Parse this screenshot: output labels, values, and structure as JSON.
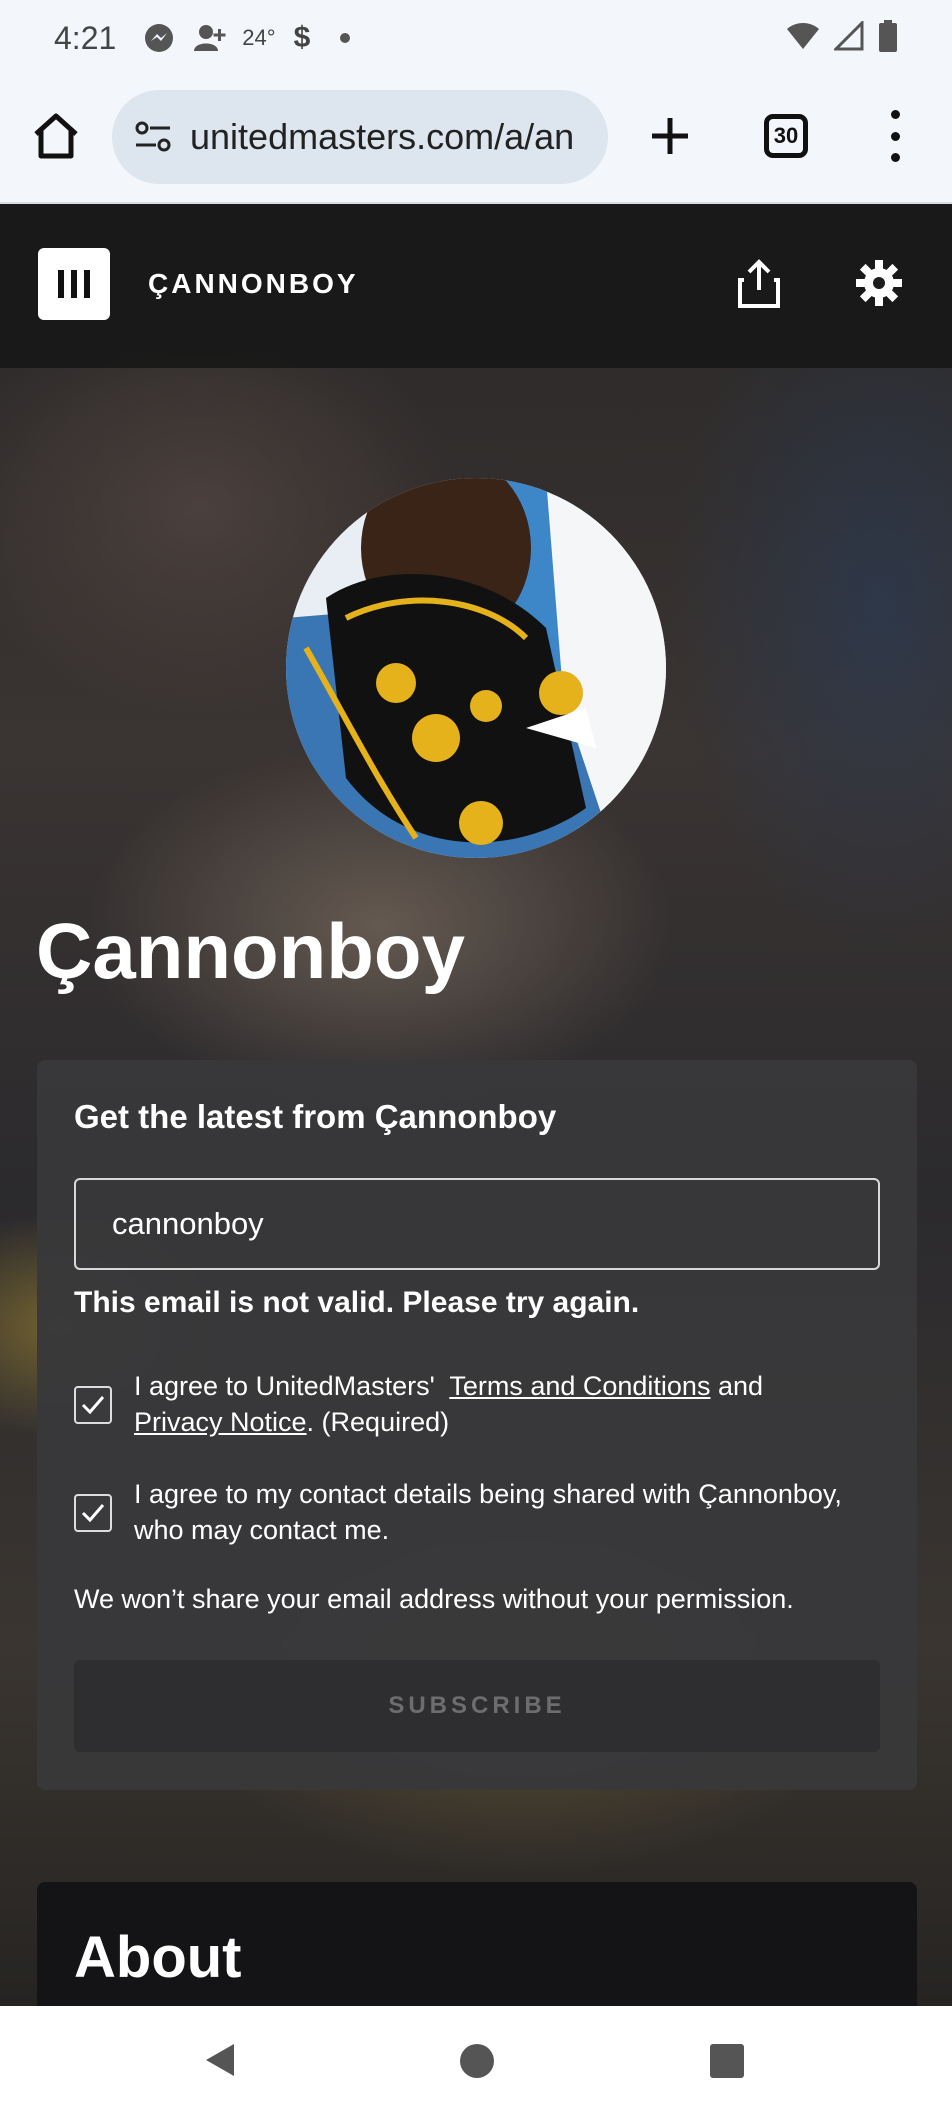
{
  "status_bar": {
    "time": "4:21",
    "temperature": "24°",
    "currency_symbol": "$"
  },
  "browser": {
    "url": "unitedmasters.com/a/an",
    "tab_count": "30"
  },
  "header": {
    "site_name": "ÇANNONBOY"
  },
  "profile": {
    "artist_name": "Çannonboy"
  },
  "subscribe_card": {
    "title": "Get the latest from Çannonboy",
    "email_value": "cannonboy",
    "error_message": "This email is not valid. Please try again.",
    "terms_prefix": "I agree to UnitedMasters'",
    "terms_link": "Terms and Conditions",
    "terms_and": "and",
    "privacy_link": "Privacy Notice",
    "privacy_suffix": ". (Required)",
    "contact_consent": "I agree to my contact details being shared with Çannonboy, who may contact me.",
    "privacy_note": "We won’t share your email address without your permission.",
    "subscribe_label": "SUBSCRIBE",
    "terms_checked": true,
    "contact_checked": true
  },
  "about": {
    "title": "About"
  },
  "colors": {
    "accent_white": "#ffffff",
    "card_bg": "#38383a",
    "header_bg": "#181818"
  }
}
